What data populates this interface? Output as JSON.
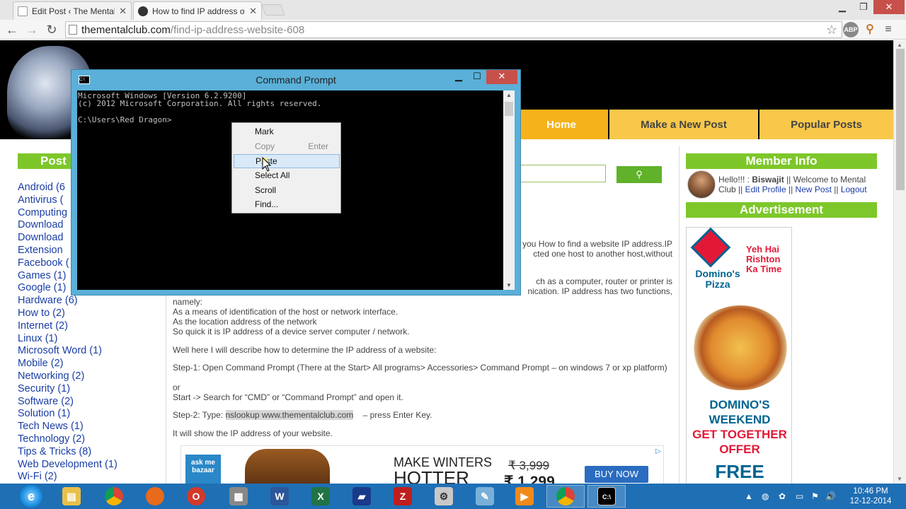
{
  "browser": {
    "tabs": [
      {
        "title": "Edit Post ‹ The Mental Clu",
        "active": false
      },
      {
        "title": "How to find IP address of",
        "active": true
      }
    ],
    "url_host": "thementalclub.com",
    "url_path": "/find-ip-address-website-608",
    "extensions": [
      "ABP",
      "≡"
    ]
  },
  "site": {
    "nav": [
      "Home",
      "Make a New Post",
      "Popular Posts"
    ],
    "sidebar_heading": "Post",
    "categories": [
      {
        "label": "Android (6"
      },
      {
        "label": "Antivirus ("
      },
      {
        "label": "Computing"
      },
      {
        "label": "Download"
      },
      {
        "label": "Download"
      },
      {
        "label": "Extension"
      },
      {
        "label": "Facebook ("
      },
      {
        "label": "Games (1)"
      },
      {
        "label": "Google (1)"
      },
      {
        "label": "Hardware (6)"
      },
      {
        "label": "How to (2)"
      },
      {
        "label": "Internet (2)"
      },
      {
        "label": "Linux (1)"
      },
      {
        "label": "Microsoft Word (1)"
      },
      {
        "label": "Mobile (2)"
      },
      {
        "label": "Networking (2)"
      },
      {
        "label": "Security (1)"
      },
      {
        "label": "Software (2)"
      },
      {
        "label": "Solution (1)"
      },
      {
        "label": "Tech News (1)"
      },
      {
        "label": "Technology (2)"
      },
      {
        "label": "Tips & Tricks (8)"
      },
      {
        "label": "Web Development (1)"
      },
      {
        "label": "Wi-Fi (2)"
      }
    ],
    "search_button_icon": "search-icon"
  },
  "article": {
    "frag1a": "you How to find a website IP address.IP",
    "frag1b": "cted one host to another host,without",
    "frag2a": "ch as a computer, router or printer is",
    "frag2b": "nication. IP address has two functions,",
    "p_namely": "namely:",
    "p_means": "As a means of identification of the host or network interface.",
    "p_location": "As the location address of the network",
    "p_quick": "So quick it is IP address of a device server computer / network.",
    "p_describe": "Well here I will describe how to determine the IP address of a website:",
    "p_step1": "Step-1: Open Command Prompt (There at the Start> All programs> Accessories> Command Prompt – on windows 7 or xp platform)",
    "p_or": "or",
    "p_start": "Start -> Search for “CMD” or “Command Prompt” and open it.",
    "step2_prefix": "Step-2: Type: ",
    "step2_cmd": "nslookup www.thementalclub.com",
    "step2_suffix": "– press Enter Key.",
    "p_show": "It will show the IP address of your website."
  },
  "banner_ad": {
    "brand": "ask me bazaar",
    "headline_1": "MAKE WINTERS",
    "headline_2": "HOTTER",
    "old_price": "₹ 3,999",
    "new_price": "₹ 1,299",
    "button": "BUY NOW"
  },
  "right_sidebar": {
    "member_heading": "Member Info",
    "greeting": "Hello!!! :",
    "username": "Biswajit",
    "welcome": "|| Welcome to Mental Club ||",
    "edit_profile": "Edit Profile",
    "new_post": "New Post",
    "logout": "Logout",
    "sep": "||",
    "ad_heading": "Advertisement"
  },
  "dominos_ad": {
    "brand_line1": "Domino's",
    "brand_line2": "Pizza",
    "slogan": "Yeh Hai Rishton Ka Time",
    "offer_line1": "DOMINO'S",
    "offer_line2": "WEEKEND",
    "offer_line3": "GET TOGETHER",
    "offer_line4": "OFFER",
    "free": "FREE"
  },
  "cmd": {
    "title": "Command Prompt",
    "console": "Microsoft Windows [Version 6.2.9200]\n(c) 2012 Microsoft Corporation. All rights reserved.\n\nC:\\Users\\Red Dragon>",
    "context_menu": {
      "mark": "Mark",
      "copy": "Copy",
      "copy_shortcut": "Enter",
      "paste": "Paste",
      "select_all": "Select All",
      "scroll": "Scroll",
      "find": "Find..."
    }
  },
  "taskbar": {
    "time": "10:46 PM",
    "date": "12-12-2014",
    "apps": [
      "ie-icon",
      "explorer-icon",
      "chrome-icon",
      "firefox-icon",
      "opera-icon",
      "calculator-icon",
      "word-icon",
      "excel-icon",
      "book-icon",
      "filezilla-icon",
      "utility-icon",
      "paint-icon",
      "media-icon",
      "chrome-icon",
      "cmd-icon"
    ]
  }
}
